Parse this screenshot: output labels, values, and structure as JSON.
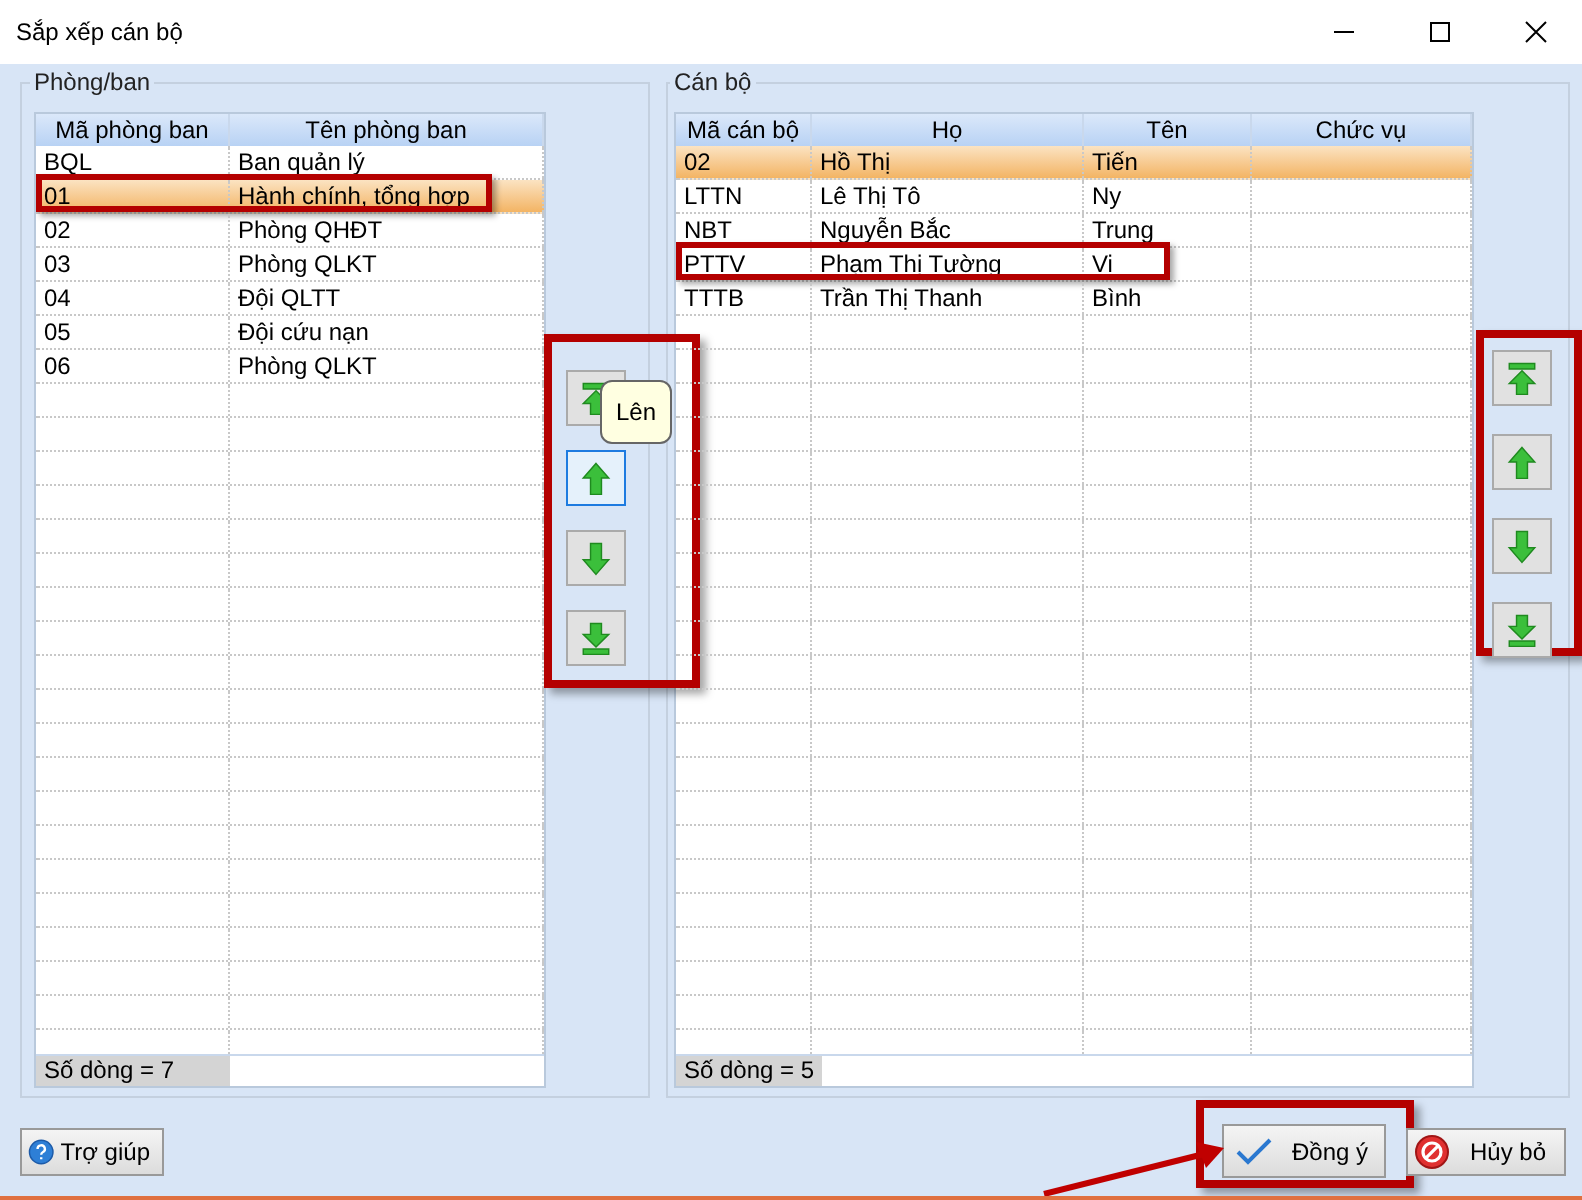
{
  "window": {
    "title": "Sắp xếp cán bộ"
  },
  "departments": {
    "title": "Phòng/ban",
    "columns": [
      "Mã phòng ban",
      "Tên phòng ban"
    ],
    "rows": [
      {
        "cells": [
          "BQL",
          "Ban quản lý"
        ],
        "selected": false,
        "highlighted": false
      },
      {
        "cells": [
          "01",
          "Hành chính, tổng hợp"
        ],
        "selected": true,
        "highlighted": true
      },
      {
        "cells": [
          "02",
          "Phòng QHĐT"
        ],
        "selected": false,
        "highlighted": false
      },
      {
        "cells": [
          "03",
          "Phòng QLKT"
        ],
        "selected": false,
        "highlighted": false
      },
      {
        "cells": [
          "04",
          "Đội QLTT"
        ],
        "selected": false,
        "highlighted": false
      },
      {
        "cells": [
          "05",
          "Đội cứu nạn"
        ],
        "selected": false,
        "highlighted": false
      },
      {
        "cells": [
          "06",
          "Phòng QLKT"
        ],
        "selected": false,
        "highlighted": false
      }
    ],
    "footer": "Số dòng = 7",
    "buttons_highlighted": true,
    "buttons": [
      {
        "kind": "top",
        "hovered": false
      },
      {
        "kind": "up",
        "hovered": true,
        "tooltip": "Lên"
      },
      {
        "kind": "down",
        "hovered": false
      },
      {
        "kind": "bottom",
        "hovered": false
      }
    ]
  },
  "staff": {
    "title": "Cán bộ",
    "columns": [
      "Mã cán bộ",
      "Họ",
      "Tên",
      "Chức vụ"
    ],
    "rows": [
      {
        "cells": [
          "02",
          "Hồ Thị",
          "Tiến",
          ""
        ],
        "selected": true,
        "highlighted": false
      },
      {
        "cells": [
          "LTTN",
          "Lê Thị Tô",
          "Ny",
          ""
        ],
        "selected": false,
        "highlighted": false
      },
      {
        "cells": [
          "NBT",
          "Nguyễn Bắc",
          "Trung",
          ""
        ],
        "selected": false,
        "highlighted": false
      },
      {
        "cells": [
          "PTTV",
          "Phạm Thị Tường",
          "Vi",
          ""
        ],
        "selected": false,
        "highlighted": true
      },
      {
        "cells": [
          "TTTB",
          "Trần Thị Thanh",
          "Bình",
          ""
        ],
        "selected": false,
        "highlighted": false
      }
    ],
    "footer": "Số dòng = 5",
    "buttons_highlighted": true,
    "buttons": [
      {
        "kind": "top",
        "hovered": false
      },
      {
        "kind": "up",
        "hovered": false
      },
      {
        "kind": "down",
        "hovered": false
      },
      {
        "kind": "bottom",
        "hovered": false
      }
    ]
  },
  "help_button": {
    "label": "Trợ giúp"
  },
  "ok_button": {
    "label": "Đồng ý",
    "highlighted": true
  },
  "cancel_button": {
    "label": "Hủy bỏ"
  }
}
